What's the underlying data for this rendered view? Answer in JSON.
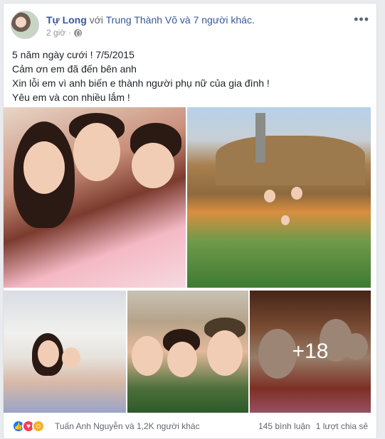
{
  "post": {
    "author": "Tự Long",
    "with_text": "với",
    "tagged": "Trung Thành Võ và 7 người khác.",
    "time": "2 giờ",
    "more": "•••",
    "lines": [
      "5 năm ngày cưới ! 7/5/2015",
      "Cảm ơn em đã đến bên anh",
      "Xin lỗi em vì anh biến e thành người phụ nữ của gia đình !",
      "Yêu em và con nhiều lắm !"
    ],
    "more_photos": "+18"
  },
  "footer": {
    "reactors": "Tuấn Anh Nguyễn và 1,2K người khác",
    "comments": "145 bình luận",
    "shares": "1 lượt chia sẻ",
    "reaction_icons": [
      "like-icon",
      "love-icon",
      "haha-icon"
    ],
    "colors": {
      "like": "#1877f2",
      "love": "#f33e58",
      "haha": "#f7b125",
      "link": "#365899"
    }
  }
}
